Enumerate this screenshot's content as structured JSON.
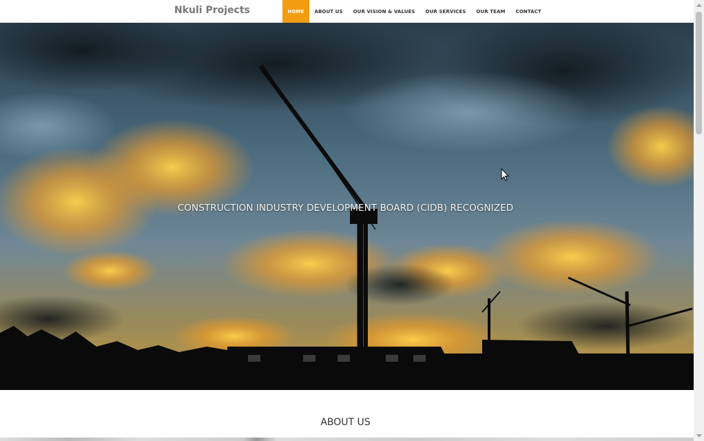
{
  "navbar": {
    "brand": "Nkuli Projects",
    "items": [
      {
        "label": "HOME",
        "active": true
      },
      {
        "label": "ABOUT US",
        "active": false
      },
      {
        "label": "OUR VISION & VALUES",
        "active": false
      },
      {
        "label": "OUR SERVICES",
        "active": false
      },
      {
        "label": "OUR TEAM",
        "active": false
      },
      {
        "label": "CONTACT",
        "active": false
      }
    ]
  },
  "hero": {
    "caption": "CONSTRUCTION INDUSTRY DEVELOPMENT BOARD (CIDB) RECOGNIZED",
    "image_subject": "construction cranes silhouetted against a sunset sky"
  },
  "about": {
    "title": "ABOUT US"
  },
  "colors": {
    "accent": "#f39c12",
    "nav_text": "#333333",
    "brand_text": "#777777"
  }
}
